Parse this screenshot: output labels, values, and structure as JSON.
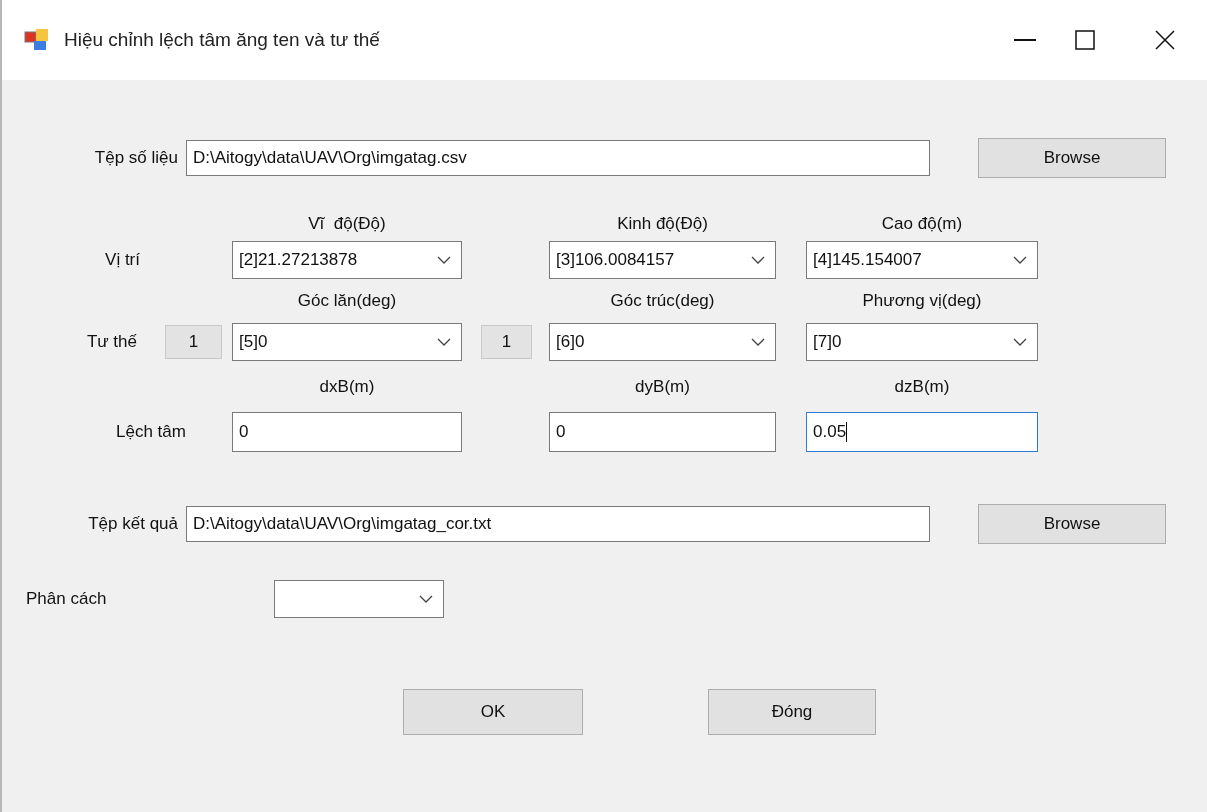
{
  "window": {
    "title": "Hiệu chỉnh lệch tâm ăng ten và tư thế"
  },
  "data_file": {
    "label": "Tệp số liệu",
    "value": "D:\\Aitogy\\data\\UAV\\Org\\imgatag.csv",
    "button": "Browse"
  },
  "position": {
    "label": "Vị trí",
    "fields": [
      {
        "heading": "Vĩ  độ(Độ)",
        "value": "[2]21.27213878"
      },
      {
        "heading": "Kinh độ(Độ)",
        "value": "[3]106.0084157"
      },
      {
        "heading": "Cao độ(m)",
        "value": "[4]145.154007"
      }
    ]
  },
  "attitude": {
    "label": "Tư thế",
    "fields": [
      {
        "heading": "Góc lăn(deg)",
        "value": "[5]0",
        "sign": "1"
      },
      {
        "heading": "Góc trúc(deg)",
        "value": "[6]0",
        "sign": "1"
      },
      {
        "heading": "Phương vị(deg)",
        "value": "[7]0"
      }
    ]
  },
  "offset": {
    "label": "Lệch tâm",
    "fields": [
      {
        "heading": "dxB(m)",
        "value": "0",
        "focused": false
      },
      {
        "heading": "dyB(m)",
        "value": "0",
        "focused": false
      },
      {
        "heading": "dzB(m)",
        "value": "0.05",
        "focused": true
      }
    ]
  },
  "result_file": {
    "label": "Tệp kết quả",
    "value": "D:\\Aitogy\\data\\UAV\\Org\\imgatag_cor.txt",
    "button": "Browse"
  },
  "separator": {
    "label": "Phân cách"
  },
  "buttons": [
    "OK",
    "Đóng"
  ]
}
